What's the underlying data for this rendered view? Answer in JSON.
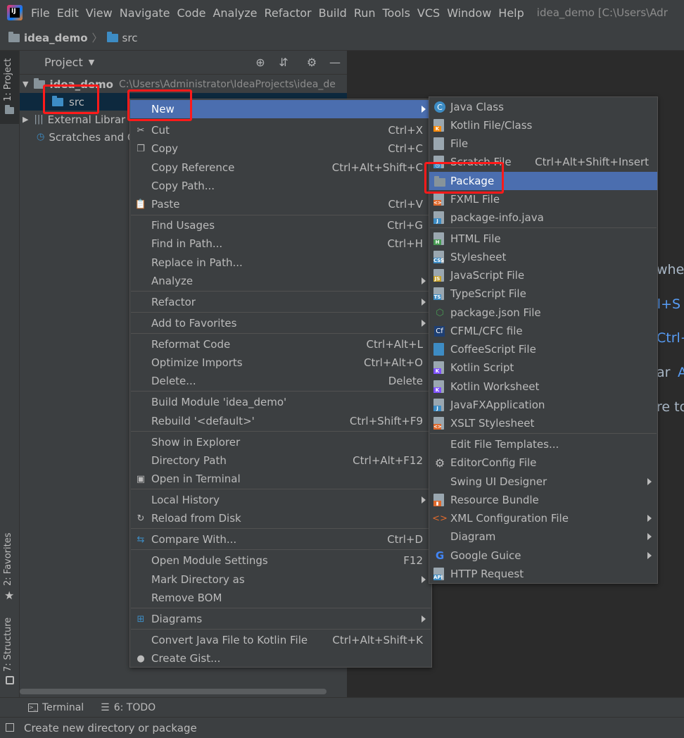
{
  "menubar": {
    "items": [
      "File",
      "Edit",
      "View",
      "Navigate",
      "Code",
      "Analyze",
      "Refactor",
      "Build",
      "Run",
      "Tools",
      "VCS",
      "Window",
      "Help"
    ],
    "window_title": "idea_demo [C:\\Users\\Adr"
  },
  "navbar": {
    "project": "idea_demo",
    "folder": "src"
  },
  "left_strip": {
    "project_tab": "1: Project",
    "favorites_tab": "2: Favorites",
    "structure_tab": "7: Structure"
  },
  "project_panel": {
    "title": "Project",
    "tree": {
      "root": "idea_demo",
      "root_path": "C:\\Users\\Administrator\\IdeaProjects\\idea_de",
      "src": "src",
      "external": "External Librar",
      "scratches": "Scratches and C"
    }
  },
  "editor_hints": {
    "h1": "wher",
    "h2": "rl+S",
    "h3": "Ctrl+",
    "h4": "ar",
    "h4b": "A",
    "h5": "re to"
  },
  "context_menu": {
    "items": [
      {
        "label": "New",
        "shortcut": "",
        "submenu": true,
        "selected": true
      },
      {
        "label": "Cut",
        "shortcut": "Ctrl+X"
      },
      {
        "label": "Copy",
        "shortcut": "Ctrl+C"
      },
      {
        "label": "Copy Reference",
        "shortcut": "Ctrl+Alt+Shift+C"
      },
      {
        "label": "Copy Path...",
        "shortcut": ""
      },
      {
        "label": "Paste",
        "shortcut": "Ctrl+V"
      },
      {
        "label": "Find Usages",
        "shortcut": "Ctrl+G"
      },
      {
        "label": "Find in Path...",
        "shortcut": "Ctrl+H"
      },
      {
        "label": "Replace in Path...",
        "shortcut": ""
      },
      {
        "label": "Analyze",
        "shortcut": "",
        "submenu": true
      },
      {
        "label": "Refactor",
        "shortcut": "",
        "submenu": true
      },
      {
        "label": "Add to Favorites",
        "shortcut": "",
        "submenu": true
      },
      {
        "label": "Reformat Code",
        "shortcut": "Ctrl+Alt+L"
      },
      {
        "label": "Optimize Imports",
        "shortcut": "Ctrl+Alt+O"
      },
      {
        "label": "Delete...",
        "shortcut": "Delete"
      },
      {
        "label": "Build Module 'idea_demo'",
        "shortcut": ""
      },
      {
        "label": "Rebuild '<default>'",
        "shortcut": "Ctrl+Shift+F9"
      },
      {
        "label": "Show in Explorer",
        "shortcut": ""
      },
      {
        "label": "Directory Path",
        "shortcut": "Ctrl+Alt+F12"
      },
      {
        "label": "Open in Terminal",
        "shortcut": ""
      },
      {
        "label": "Local History",
        "shortcut": "",
        "submenu": true
      },
      {
        "label": "Reload from Disk",
        "shortcut": ""
      },
      {
        "label": "Compare With...",
        "shortcut": "Ctrl+D"
      },
      {
        "label": "Open Module Settings",
        "shortcut": "F12"
      },
      {
        "label": "Mark Directory as",
        "shortcut": "",
        "submenu": true
      },
      {
        "label": "Remove BOM",
        "shortcut": ""
      },
      {
        "label": "Diagrams",
        "shortcut": "",
        "submenu": true
      },
      {
        "label": "Convert Java File to Kotlin File",
        "shortcut": "Ctrl+Alt+Shift+K"
      },
      {
        "label": "Create Gist...",
        "shortcut": ""
      }
    ]
  },
  "new_submenu": {
    "items": [
      {
        "label": "Java Class",
        "shortcut": ""
      },
      {
        "label": "Kotlin File/Class",
        "shortcut": ""
      },
      {
        "label": "File",
        "shortcut": ""
      },
      {
        "label": "Scratch File",
        "shortcut": "Ctrl+Alt+Shift+Insert"
      },
      {
        "label": "Package",
        "shortcut": "",
        "selected": true
      },
      {
        "label": "FXML File",
        "shortcut": ""
      },
      {
        "label": "package-info.java",
        "shortcut": ""
      },
      {
        "label": "HTML File",
        "shortcut": ""
      },
      {
        "label": "Stylesheet",
        "shortcut": ""
      },
      {
        "label": "JavaScript File",
        "shortcut": ""
      },
      {
        "label": "TypeScript File",
        "shortcut": ""
      },
      {
        "label": "package.json File",
        "shortcut": ""
      },
      {
        "label": "CFML/CFC file",
        "shortcut": ""
      },
      {
        "label": "CoffeeScript File",
        "shortcut": ""
      },
      {
        "label": "Kotlin Script",
        "shortcut": ""
      },
      {
        "label": "Kotlin Worksheet",
        "shortcut": ""
      },
      {
        "label": "JavaFXApplication",
        "shortcut": ""
      },
      {
        "label": "XSLT Stylesheet",
        "shortcut": ""
      },
      {
        "label": "Edit File Templates...",
        "shortcut": ""
      },
      {
        "label": "EditorConfig File",
        "shortcut": ""
      },
      {
        "label": "Swing UI Designer",
        "shortcut": "",
        "submenu": true
      },
      {
        "label": "Resource Bundle",
        "shortcut": ""
      },
      {
        "label": "XML Configuration File",
        "shortcut": "",
        "submenu": true
      },
      {
        "label": "Diagram",
        "shortcut": "",
        "submenu": true
      },
      {
        "label": "Google Guice",
        "shortcut": "",
        "submenu": true
      },
      {
        "label": "HTTP Request",
        "shortcut": ""
      }
    ]
  },
  "bottom_tabs": {
    "terminal": "Terminal",
    "todo": "6: TODO"
  },
  "status": {
    "text": "Create new directory or package"
  },
  "colors": {
    "selection": "#4b6eaf",
    "highlight_box": "#ff1a1a",
    "background": "#3c3f41",
    "editor": "#2b2b2b"
  }
}
